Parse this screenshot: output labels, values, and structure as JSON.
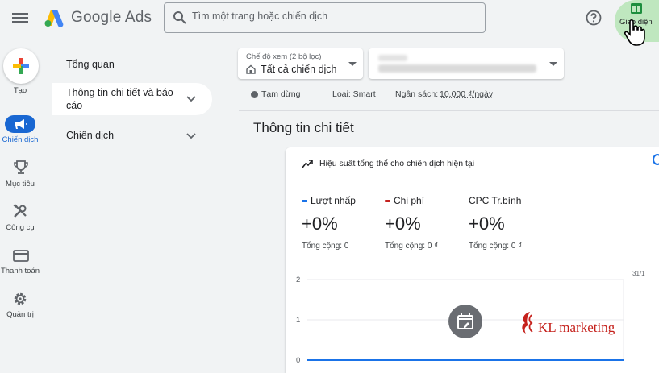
{
  "header": {
    "app_title": "Google Ads",
    "search_placeholder": "Tìm một trang hoặc chiến dịch",
    "appearance_label": "Giao diện",
    "brand_colors": {
      "blue": "#4285f4",
      "yellow": "#fbbc04",
      "green": "#34a853"
    }
  },
  "rail": {
    "items": [
      {
        "label": "Tạo",
        "icon": "plus-icon"
      },
      {
        "label": "Chiến dịch",
        "icon": "megaphone-icon",
        "active": true
      },
      {
        "label": "Mục tiêu",
        "icon": "trophy-icon"
      },
      {
        "label": "Công cụ",
        "icon": "tools-icon"
      },
      {
        "label": "Thanh toán",
        "icon": "credit-card-icon"
      },
      {
        "label": "Quản trị",
        "icon": "gear-icon"
      }
    ],
    "accent": "#1967d2"
  },
  "subnav": {
    "items": [
      {
        "label": "Tổng quan"
      },
      {
        "label": "Thông tin chi tiết và báo cáo",
        "active": true,
        "expandable": true
      },
      {
        "label": "Chiến dịch",
        "expandable": true
      }
    ]
  },
  "filters": {
    "view_label": "Chế độ xem (2 bộ lọc)",
    "view_value": "Tất cả chiến dịch"
  },
  "status": {
    "state": "Tạm dừng",
    "type": "Loại: Smart",
    "budget_label": "Ngân sách:",
    "budget_value": "10.000 ₫/ngày"
  },
  "main": {
    "section_title": "Thông tin chi tiết",
    "card": {
      "header": "Hiệu suất tổng thể cho chiến dịch hiện tại",
      "metrics": [
        {
          "name": "Lượt nhấp",
          "value": "+0%",
          "total": "Tổng cộng: 0",
          "color": "#1a73e8"
        },
        {
          "name": "Chi phí",
          "value": "+0%",
          "total": "Tổng cộng: 0 ₫",
          "color": "#c5221f"
        },
        {
          "name": "CPC Tr.bình",
          "value": "+0%",
          "total": "Tổng cộng: 0 ₫",
          "color": null
        }
      ]
    }
  },
  "chart_data": {
    "type": "line",
    "x": [
      "31/1"
    ],
    "y_ticks": [
      "2",
      "1",
      "0"
    ],
    "ylim": [
      0,
      2
    ],
    "series": [
      {
        "values": [
          0
        ],
        "color": "#1a73e8"
      }
    ],
    "grid": true
  },
  "watermark": {
    "brand_text": "KL marketing",
    "color": "#c5211c"
  }
}
